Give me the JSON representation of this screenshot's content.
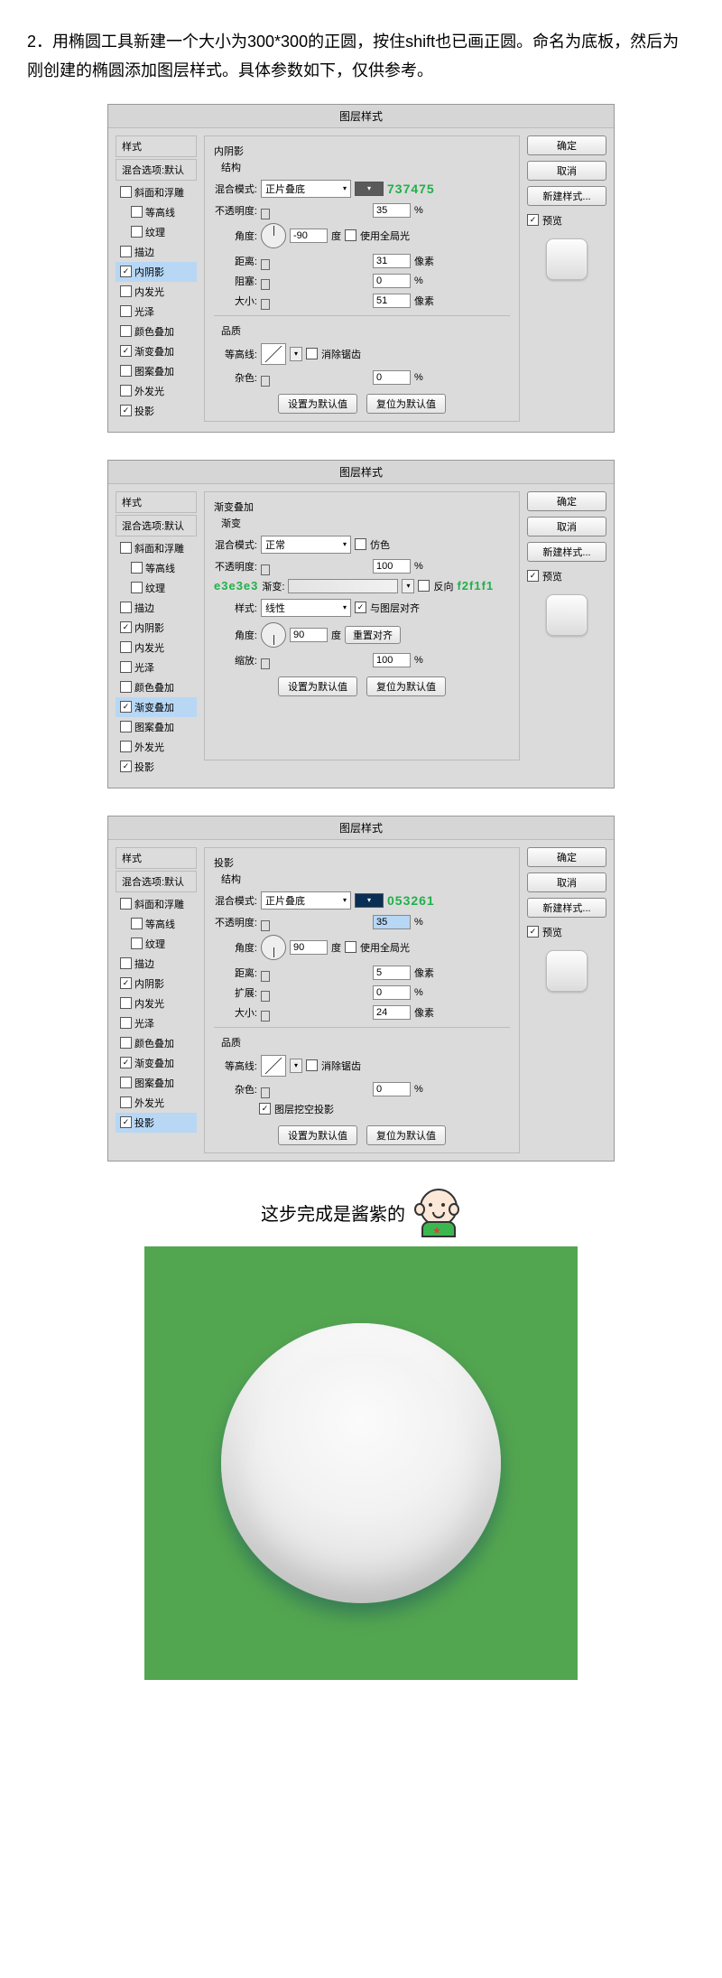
{
  "instruction": "2．用椭圆工具新建一个大小为300*300的正圆，按住shift也已画正圆。命名为底板，然后为刚创建的椭圆添加图层样式。具体参数如下，仅供参考。",
  "dialog_title": "图层样式",
  "styles": {
    "hdr1": "样式",
    "hdr2": "混合选项:默认",
    "items": [
      "斜面和浮雕",
      "等高线",
      "纹理",
      "描边",
      "内阴影",
      "内发光",
      "光泽",
      "颜色叠加",
      "渐变叠加",
      "图案叠加",
      "外发光",
      "投影"
    ]
  },
  "right": {
    "ok": "确定",
    "cancel": "取消",
    "new_style": "新建样式...",
    "preview": "预览"
  },
  "common": {
    "blend_mode": "混合模式:",
    "opacity": "不透明度:",
    "angle": "角度:",
    "degree": "度",
    "use_global": "使用全局光",
    "distance": "距离:",
    "choke": "阻塞:",
    "size": "大小:",
    "px": "像素",
    "pct": "%",
    "quality": "品质",
    "contour": "等高线:",
    "antialias": "消除锯齿",
    "noise": "杂色:",
    "structure": "结构",
    "set_default": "设置为默认值",
    "reset_default": "复位为默认值",
    "spread": "扩展:",
    "knockout": "图层挖空投影"
  },
  "panel1": {
    "title": "内阴影",
    "mode_val": "正片叠底",
    "hex": "737475",
    "opacity": "35",
    "angle": "-90",
    "distance": "31",
    "choke": "0",
    "size": "51",
    "noise": "0"
  },
  "panel2": {
    "title": "渐变叠加",
    "sub": "渐变",
    "mode_val": "正常",
    "dither": "仿色",
    "opacity": "100",
    "grad_label": "渐变:",
    "reverse": "反向",
    "hex_left": "e3e3e3",
    "hex_right": "f2f1f1",
    "style_label": "样式:",
    "style_val": "线性",
    "align": "与图层对齐",
    "angle": "90",
    "realign": "重置对齐",
    "scale_label": "缩放:",
    "scale": "100"
  },
  "panel3": {
    "title": "投影",
    "mode_val": "正片叠底",
    "hex": "053261",
    "opacity": "35",
    "angle": "90",
    "distance": "5",
    "spread": "0",
    "size": "24",
    "noise": "0"
  },
  "caption": "这步完成是酱紫的"
}
